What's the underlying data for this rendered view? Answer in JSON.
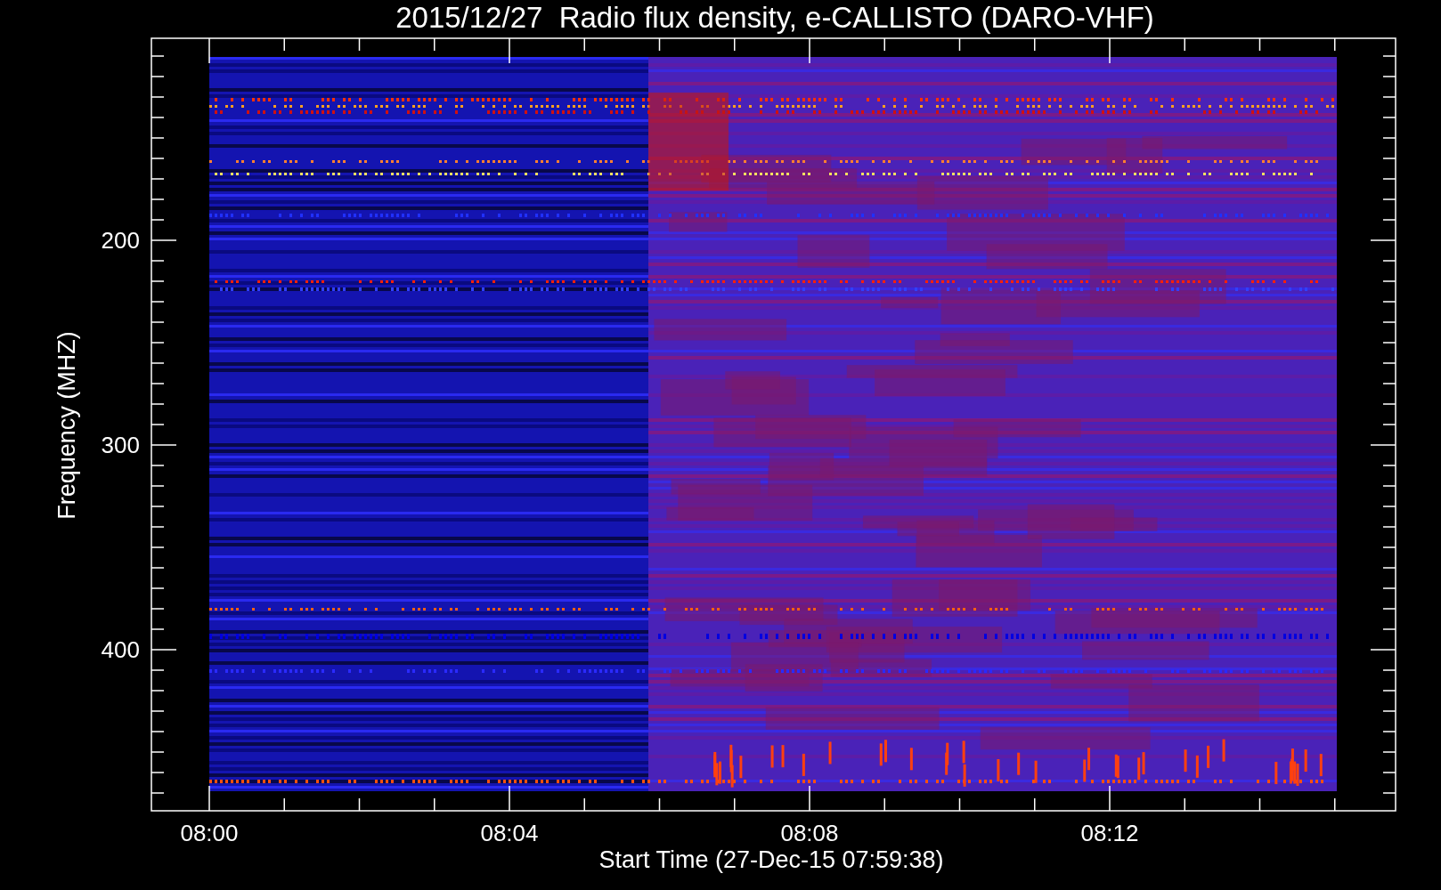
{
  "title": "2015/12/27  Radio flux density, e-CALLISTO (DARO-VHF)",
  "xlabel": "Start Time (27-Dec-15 07:59:38)",
  "ylabel": "Frequency (MHZ)",
  "xticks": [
    "08:00",
    "08:04",
    "08:08",
    "08:12"
  ],
  "yticks": [
    "200",
    "300",
    "400"
  ]
}
